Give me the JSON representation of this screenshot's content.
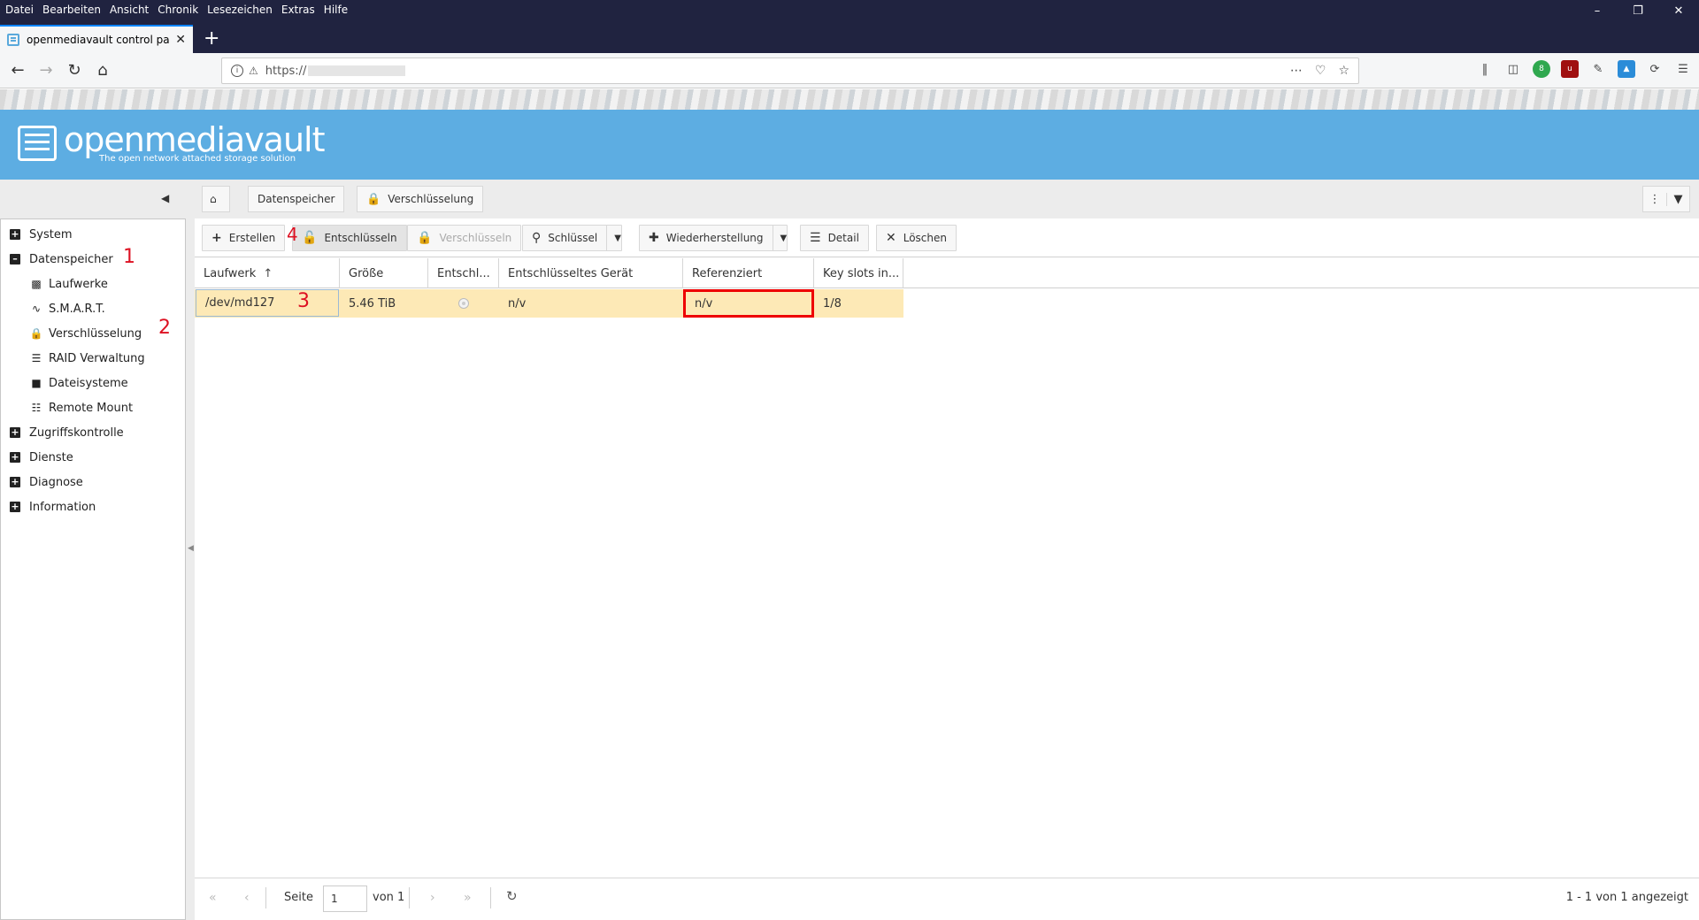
{
  "browser": {
    "menu": [
      "Datei",
      "Bearbeiten",
      "Ansicht",
      "Chronik",
      "Lesezeichen",
      "Extras",
      "Hilfe"
    ],
    "tab_title": "openmediavault control panel",
    "url": "https://"
  },
  "app": {
    "name": "openmediavault",
    "tagline": "The open network attached storage solution"
  },
  "sidebar": {
    "items": [
      {
        "label": "System",
        "type": "group",
        "expanded": false
      },
      {
        "label": "Datenspeicher",
        "type": "group",
        "expanded": true
      },
      {
        "label": "Laufwerke",
        "type": "child",
        "icon": "disk-icon"
      },
      {
        "label": "S.M.A.R.T.",
        "type": "child",
        "icon": "heartbeat-icon"
      },
      {
        "label": "Verschlüsselung",
        "type": "child",
        "icon": "lock-icon"
      },
      {
        "label": "RAID Verwaltung",
        "type": "child",
        "icon": "database-icon"
      },
      {
        "label": "Dateisysteme",
        "type": "child",
        "icon": "folder-icon"
      },
      {
        "label": "Remote Mount",
        "type": "child",
        "icon": "sitemap-icon"
      },
      {
        "label": "Zugriffskontrolle",
        "type": "group",
        "expanded": false
      },
      {
        "label": "Dienste",
        "type": "group",
        "expanded": false
      },
      {
        "label": "Diagnose",
        "type": "group",
        "expanded": false
      },
      {
        "label": "Information",
        "type": "group",
        "expanded": false
      }
    ]
  },
  "annotations": [
    "1",
    "2",
    "3",
    "4"
  ],
  "breadcrumb": {
    "items": [
      "Datenspeicher",
      "Verschlüsselung"
    ]
  },
  "toolbar": {
    "create": "Erstellen",
    "unlock": "Entschlüsseln",
    "lock": "Verschlüsseln",
    "key": "Schlüssel",
    "restore": "Wiederherstellung",
    "detail": "Detail",
    "delete": "Löschen"
  },
  "grid": {
    "columns": [
      "Laufwerk",
      "Größe",
      "Entschl...",
      "Entschlüsseltes Gerät",
      "Referenziert",
      "Key slots in..."
    ],
    "rows": [
      {
        "device": "/dev/md127",
        "size": "5.46 TiB",
        "decrypted": false,
        "decrypted_device": "n/v",
        "referenced": "n/v",
        "key_slots": "1/8"
      }
    ]
  },
  "pager": {
    "page_label": "Seite",
    "page_value": "1",
    "of_label": "von 1",
    "info": "1 - 1 von 1 angezeigt"
  },
  "colors": {
    "header_blue": "#5dade2",
    "row_selected": "#fde9b6",
    "annotation_red": "#dd1122"
  }
}
